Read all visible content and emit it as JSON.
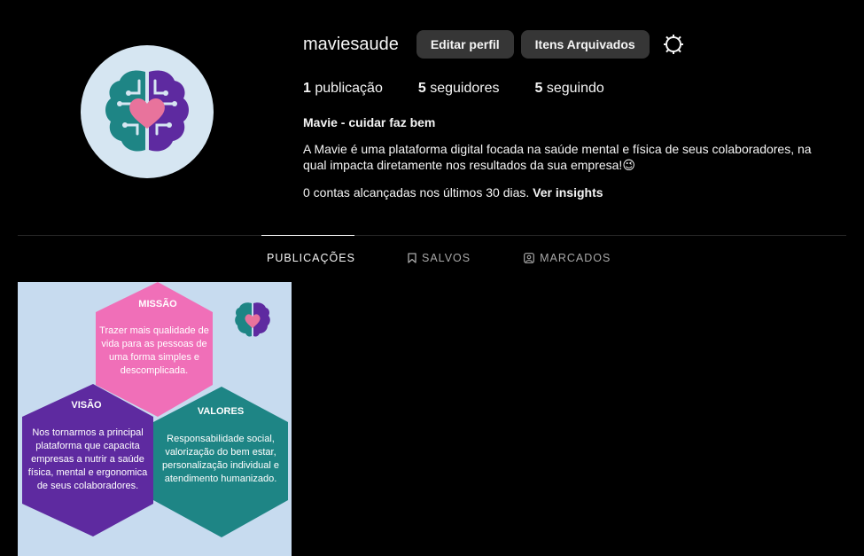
{
  "profile": {
    "username": "maviesaude",
    "edit_button": "Editar perfil",
    "archive_button": "Itens Arquivados",
    "settings_icon": "gear-icon",
    "stats": {
      "posts_count": "1",
      "posts_label": " publicação",
      "followers_count": "5",
      "followers_label": " seguidores",
      "following_count": "5",
      "following_label": " seguindo"
    },
    "full_name": "Mavie - cuidar faz bem",
    "bio": "A Mavie é uma plataforma digital focada na saúde mental e física de seus colaboradores, na qual impacta diretamente nos resultados da sua empresa!😉",
    "insights_text": "0 contas alcançadas nos últimos 30 dias. ",
    "insights_link": "Ver insights"
  },
  "tabs": [
    {
      "label": "PUBLICAÇÕES",
      "icon": "grid-icon",
      "active": true
    },
    {
      "label": "SALVOS",
      "icon": "bookmark-icon",
      "active": false
    },
    {
      "label": "MARCADOS",
      "icon": "tagged-icon",
      "active": false
    }
  ],
  "post": {
    "mission_title": "MISSÃO",
    "mission_text": "Trazer mais qualidade de vida para as pessoas de uma forma simples e descomplicada.",
    "vision_title": "VISÃO",
    "vision_text": "Nos tornarmos a principal plataforma que capacita empresas a nutrir a saúde física, mental e ergonomica de seus colaboradores.",
    "values_title": "VALORES",
    "values_text": "Responsabilidade social, valorização do bem estar, personalização individual e atendimento humanizado."
  },
  "colors": {
    "background": "#000000",
    "button_bg": "#363636",
    "teal": "#1e8585",
    "purple": "#5e2aa0",
    "pink": "#f06fb8",
    "heart": "#e8739c",
    "post_bg": "#c7dbef"
  }
}
